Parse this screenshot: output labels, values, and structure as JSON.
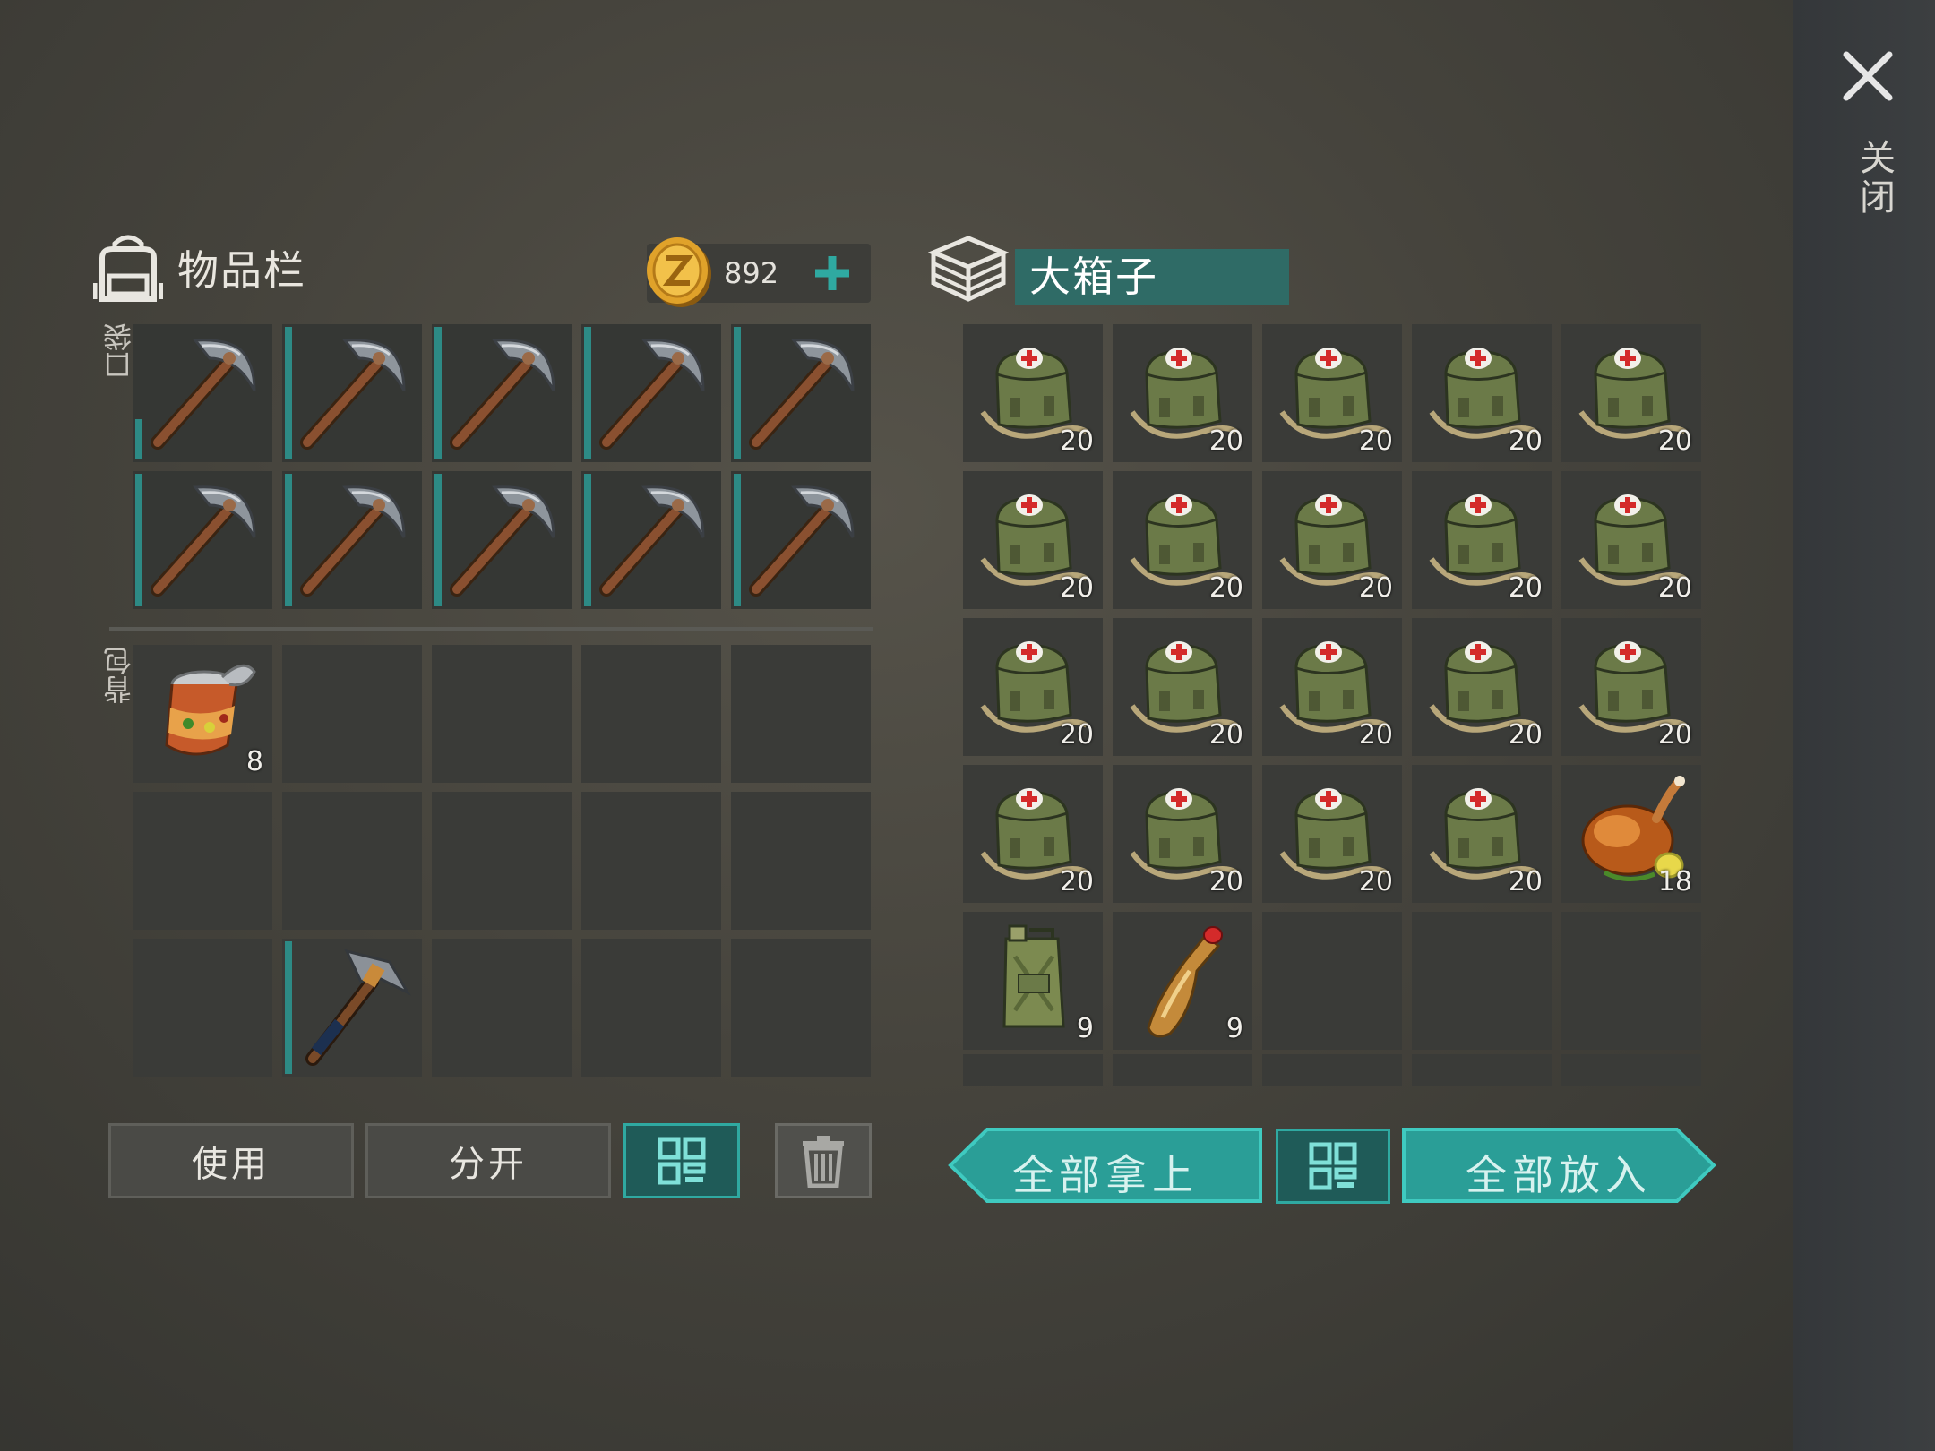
{
  "close": {
    "label": "关闭",
    "icon": "close-icon"
  },
  "inventory": {
    "title": "物品栏",
    "icon": "backpack-icon",
    "coins": {
      "value": "892",
      "icon": "coin-icon"
    },
    "pockets_label": "口袋",
    "backpack_label": "背包",
    "pockets": [
      {
        "item": "pickaxe",
        "durability": "low"
      },
      {
        "item": "pickaxe",
        "durability": "full"
      },
      {
        "item": "pickaxe",
        "durability": "full"
      },
      {
        "item": "pickaxe",
        "durability": "full"
      },
      {
        "item": "pickaxe",
        "durability": "full"
      },
      {
        "item": "pickaxe",
        "durability": "full"
      },
      {
        "item": "pickaxe",
        "durability": "full"
      },
      {
        "item": "pickaxe",
        "durability": "full"
      },
      {
        "item": "pickaxe",
        "durability": "full"
      },
      {
        "item": "pickaxe",
        "durability": "full"
      }
    ],
    "backpack": [
      {
        "item": "canned-food",
        "qty": "8"
      },
      {},
      {},
      {},
      {},
      {},
      {},
      {},
      {},
      {},
      {},
      {
        "item": "hammer",
        "durability": "full"
      },
      {},
      {},
      {}
    ],
    "buttons": {
      "use": "使用",
      "split": "分开"
    }
  },
  "container": {
    "title": "大箱子",
    "icon": "crate-icon",
    "slots": [
      {
        "item": "medkit",
        "qty": "20"
      },
      {
        "item": "medkit",
        "qty": "20"
      },
      {
        "item": "medkit",
        "qty": "20"
      },
      {
        "item": "medkit",
        "qty": "20"
      },
      {
        "item": "medkit",
        "qty": "20"
      },
      {
        "item": "medkit",
        "qty": "20"
      },
      {
        "item": "medkit",
        "qty": "20"
      },
      {
        "item": "medkit",
        "qty": "20"
      },
      {
        "item": "medkit",
        "qty": "20"
      },
      {
        "item": "medkit",
        "qty": "20"
      },
      {
        "item": "medkit",
        "qty": "20"
      },
      {
        "item": "medkit",
        "qty": "20"
      },
      {
        "item": "medkit",
        "qty": "20"
      },
      {
        "item": "medkit",
        "qty": "20"
      },
      {
        "item": "medkit",
        "qty": "20"
      },
      {
        "item": "medkit",
        "qty": "20"
      },
      {
        "item": "medkit",
        "qty": "20"
      },
      {
        "item": "medkit",
        "qty": "20"
      },
      {
        "item": "medkit",
        "qty": "20"
      },
      {
        "item": "roast-chicken",
        "qty": "18"
      },
      {
        "item": "jerrycan",
        "qty": "9"
      },
      {
        "item": "bottle",
        "qty": "9"
      },
      {},
      {},
      {}
    ],
    "buttons": {
      "take_all": "全部拿上",
      "put_all": "全部放入"
    }
  },
  "colors": {
    "accent": "#2fa9a1",
    "slot": "#3a3b38",
    "title_bg": "#2f6b66"
  }
}
